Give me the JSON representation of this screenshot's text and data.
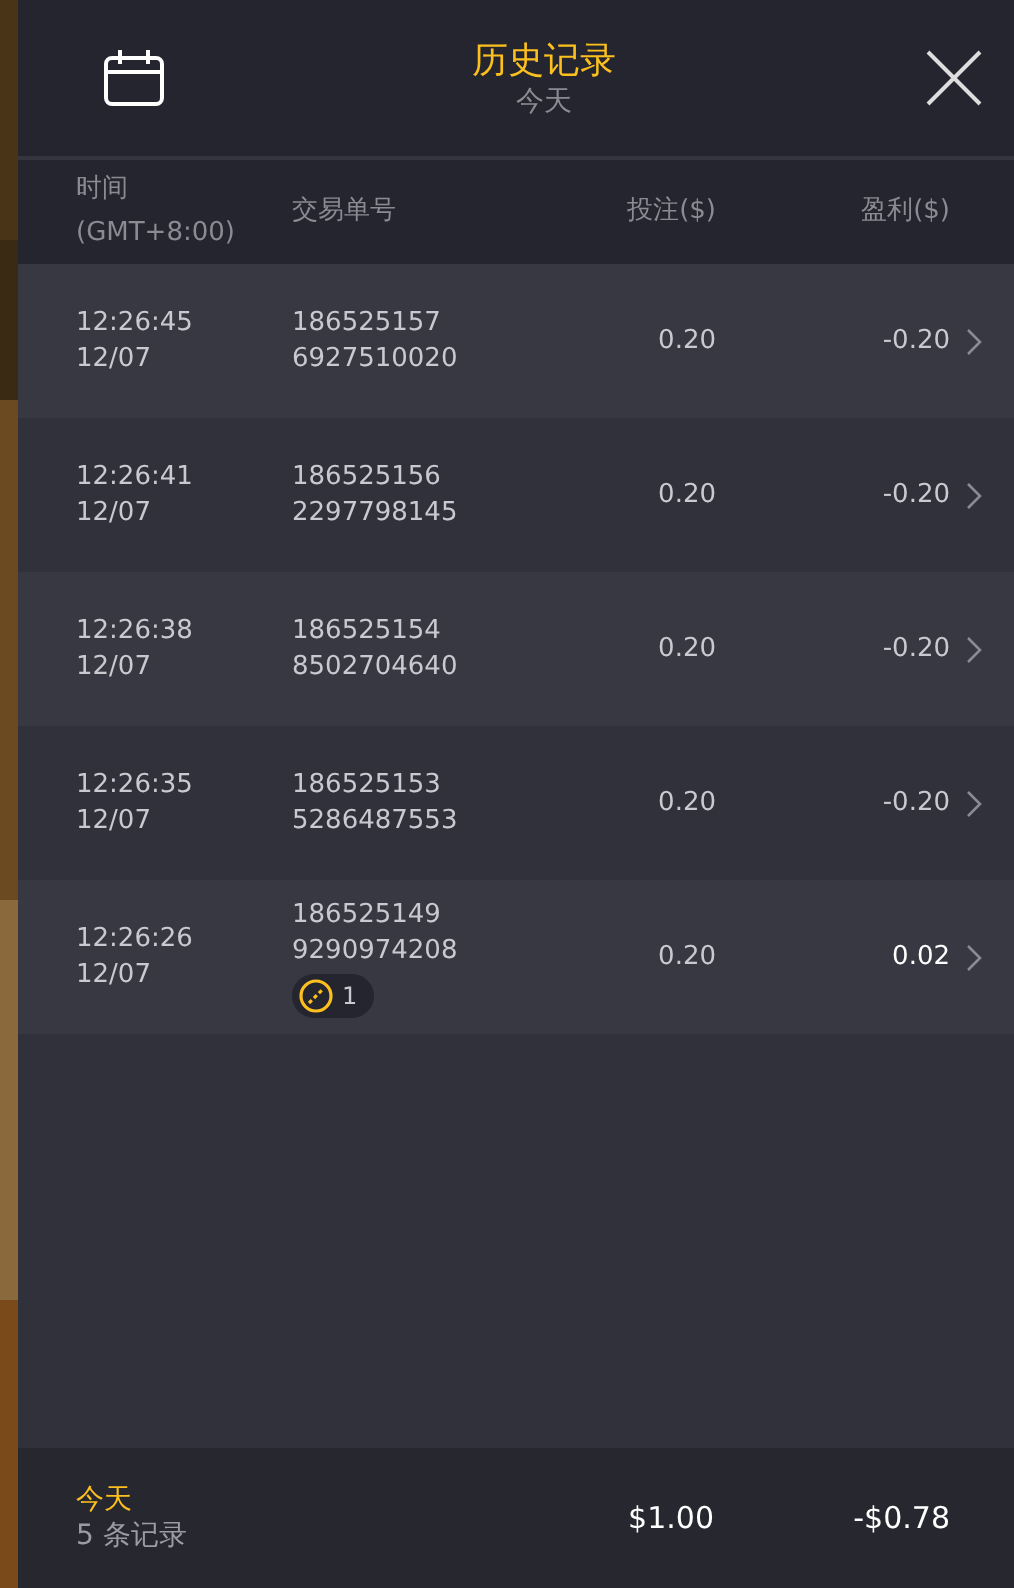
{
  "header": {
    "title": "历史记录",
    "subtitle": "今天"
  },
  "columns": [
    {
      "label": "时间",
      "sub": "(GMT+8:00)"
    },
    {
      "label": "交易单号"
    },
    {
      "label": "投注($)"
    },
    {
      "label": "盈利($)"
    }
  ],
  "rows": [
    {
      "time": "12:26:45",
      "date": "12/07",
      "id_1": "186525157",
      "id_2": "6927510020",
      "bet": "0.20",
      "profit": "-0.20",
      "win": false
    },
    {
      "time": "12:26:41",
      "date": "12/07",
      "id_1": "186525156",
      "id_2": "2297798145",
      "bet": "0.20",
      "profit": "-0.20",
      "win": false
    },
    {
      "time": "12:26:38",
      "date": "12/07",
      "id_1": "186525154",
      "id_2": "8502704640",
      "bet": "0.20",
      "profit": "-0.20",
      "win": false
    },
    {
      "time": "12:26:35",
      "date": "12/07",
      "id_1": "186525153",
      "id_2": "5286487553",
      "bet": "0.20",
      "profit": "-0.20",
      "win": false
    },
    {
      "time": "12:26:26",
      "date": "12/07",
      "id_1": "186525149",
      "id_2": "9290974208",
      "badge": "1",
      "bet": "0.20",
      "profit": "0.02",
      "win": true
    }
  ],
  "footer": {
    "period": "今天",
    "count": "5 条记录",
    "total_bet": "$1.00",
    "total_profit": "-$0.78"
  }
}
